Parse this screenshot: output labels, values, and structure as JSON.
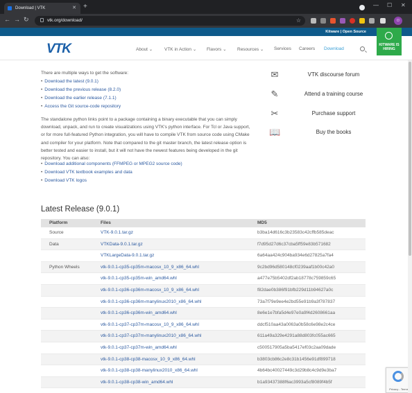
{
  "browser": {
    "tab_title": "Download | VTK",
    "url": "vtk.org/download/"
  },
  "site": {
    "topbar_text": "Kitware | Open Source",
    "hiring": "KITWARE IS HIRING",
    "logo": "VTK",
    "nav": [
      {
        "label": "About ⌄"
      },
      {
        "label": "VTK in Action ⌄"
      },
      {
        "label": "Flavors ⌄"
      },
      {
        "label": "Resources ⌄"
      },
      {
        "label": "Services"
      },
      {
        "label": "Careers"
      },
      {
        "label": "Download"
      }
    ]
  },
  "intro": {
    "lead": "There are multiple ways to get the software:",
    "links": [
      "Download the latest (9.0.1)",
      "Download the previous release (8.2.0)",
      "Download the earlier release (7.1.1)",
      "Access the Git source-code repository"
    ],
    "paragraph": "The standalone python links point to a package containing a binary executable that you can simply download, unpack, and run to create visualizations using VTK's python interface. For Tcl or Java support, or for more full-featured Python integration, you will have to compile VTK from source code using CMake and compiler for your platform. Note that compared to the git master branch, the latest release option is better tested and easier to install, but it will not have the newest features being developed in the git repository. You can also:",
    "extra_links": [
      "Download additional components (FFMPEG or MPEG2 source code)",
      "Download VTK textbook examples and data",
      "Download VTK logos"
    ]
  },
  "sidebar": [
    {
      "icon": "✉",
      "label": "VTK discourse forum"
    },
    {
      "icon": "✎",
      "label": "Attend a training course"
    },
    {
      "icon": "✂",
      "label": "Purchase support"
    },
    {
      "icon": "📖",
      "label": "Buy the books"
    }
  ],
  "release": {
    "heading": "Latest Release (9.0.1)",
    "columns": [
      "Platform",
      "Files",
      "MD5"
    ],
    "rows": [
      {
        "platform": "Source",
        "file": "VTK-9.0.1.tar.gz",
        "md5": "b3ba14d616c3b23583c42cffb585deac"
      },
      {
        "platform": "Data",
        "file": "VTKData-9.0.1.tar.gz",
        "md5": "f7d95d27d6c37cba5ff59e83b571682"
      },
      {
        "platform": "",
        "file": "VTKLargeData-9.0.1.tar.gz",
        "md5": "6a64aa424c904ba934e6d27825a7fa4"
      },
      {
        "platform": "Python Wheels",
        "file": "vtk-9.0.1-cp35-cp35m-macosx_10_9_x86_64.whl",
        "md5": "9c2bd96d580148cf0239aaf1b00c42a0"
      },
      {
        "platform": "",
        "file": "vtk-9.0.1-cp35-cp35m-win_amd64.whl",
        "md5": "a477e75b5402df2ab18778c759859c65"
      },
      {
        "platform": "",
        "file": "vtk-9.0.1-cp36-cp36m-macosx_10_9_x86_64.whl",
        "md5": "f82dae0b386f91bfb229d11b94627a0c"
      },
      {
        "platform": "",
        "file": "vtk-9.0.1-cp36-cp36m-manylinux2010_x86_64.whl",
        "md5": "73a7f79e9ee4e2bd55e91b9a3f787837"
      },
      {
        "platform": "",
        "file": "vtk-9.0.1-cp36-cp36m-win_amd64.whl",
        "md5": "8e6e1e7bfa5d4e97e0a9f4d2608661aa"
      },
      {
        "platform": "",
        "file": "vtk-9.0.1-cp37-cp37m-macosx_10_9_x86_64.whl",
        "md5": "ddcf510aa43a0063a0b58c6e98e2c4ce"
      },
      {
        "platform": "",
        "file": "vtk-9.0.1-cp37-cp37m-manylinux2010_x86_64.whl",
        "md5": "611a49a329e4291a88d803fc055ac665"
      },
      {
        "platform": "",
        "file": "vtk-9.0.1-cp37-cp37m-win_amd64.whl",
        "md5": "c500517905a5ba5417ef03c2aa09dade"
      },
      {
        "platform": "",
        "file": "vtk-9.0.1-cp38-cp38-macosx_10_9_x86_64.whl",
        "md5": "b3803cb86c2e8c31b1456e91df899718"
      },
      {
        "platform": "",
        "file": "vtk-9.0.1-cp38-cp38-manylinux2010_x86_64.whl",
        "md5": "4b64bc40027449c3d29b8c4c9d9e3ba7"
      },
      {
        "platform": "",
        "file": "vtk-9.0.1-cp38-cp38-win_amd64.whl",
        "md5": "b1a93437388f6ac3993a5cf8089f4b5f"
      }
    ]
  },
  "recaptcha": {
    "text": "Privacy - Terms"
  }
}
